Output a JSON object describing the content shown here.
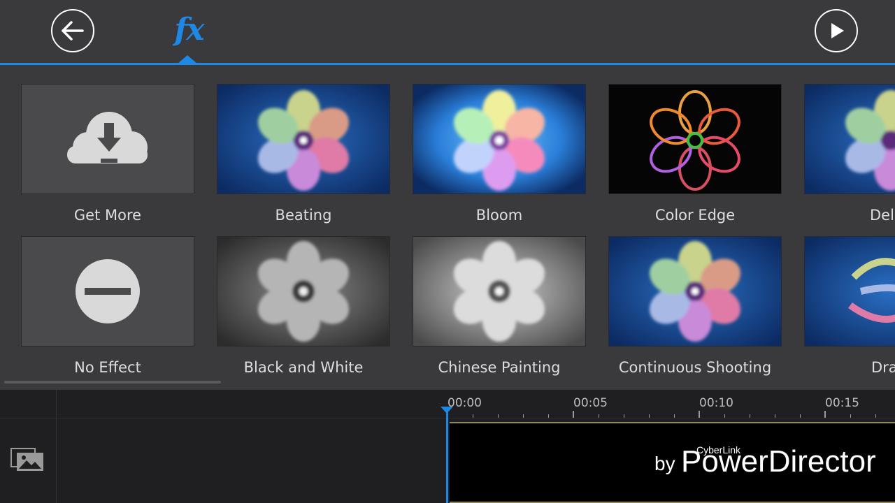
{
  "toolbar": {
    "back_icon": "arrow-left-icon",
    "fx_tab_label": "fx",
    "play_icon": "play-icon",
    "accent_color": "#1e88e5"
  },
  "effects": {
    "row1": [
      {
        "name": "Get More",
        "icon": "cloud-download-icon"
      },
      {
        "name": "Beating"
      },
      {
        "name": "Bloom"
      },
      {
        "name": "Color Edge"
      },
      {
        "name": "Del"
      }
    ],
    "row2": [
      {
        "name": "No Effect",
        "icon": "no-entry-icon"
      },
      {
        "name": "Black and White"
      },
      {
        "name": "Chinese Painting"
      },
      {
        "name": "Continuous Shooting"
      },
      {
        "name": "Dra"
      }
    ]
  },
  "timeline": {
    "ticks": [
      "00:00",
      "00:05",
      "00:10",
      "00:15"
    ],
    "media_icon": "media-library-icon"
  },
  "watermark": {
    "by": "by",
    "brand_small": "CyberLink",
    "brand": "PowerDirector"
  }
}
